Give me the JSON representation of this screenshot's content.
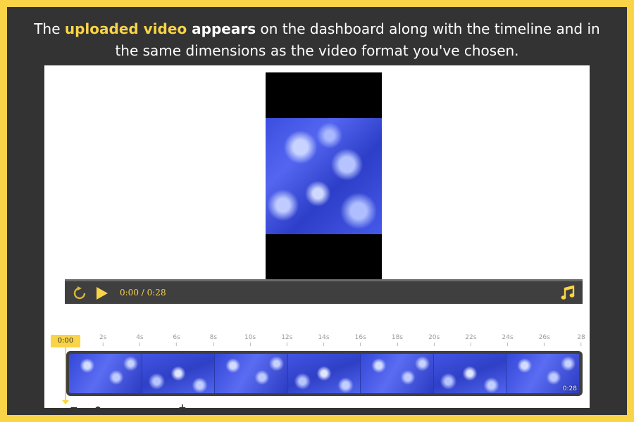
{
  "caption": {
    "part1": "The ",
    "highlight": "uploaded video",
    "bold": " appears",
    "part2": " on the dashboard along with the timeline and in the same dimensions as the video format you've chosen."
  },
  "player": {
    "current_time": "0:00",
    "separator": " / ",
    "total_time": "0:28",
    "icons": [
      "replay-icon",
      "play-icon",
      "music-note-icon"
    ]
  },
  "timeline": {
    "playhead_label": "0:00",
    "ticks": [
      "2s",
      "4s",
      "6s",
      "8s",
      "10s",
      "12s",
      "14s",
      "16s",
      "18s",
      "20s",
      "22s",
      "24s",
      "26s",
      "28"
    ],
    "clip_duration": "0:28",
    "thumbnail_count": 7,
    "zoom": {
      "minus_label": "−",
      "plus_label": "+",
      "level": 0.12
    }
  },
  "colors": {
    "border": "#f9d447",
    "accent": "#f9d447",
    "background": "#333333",
    "panel": "#ffffff"
  }
}
